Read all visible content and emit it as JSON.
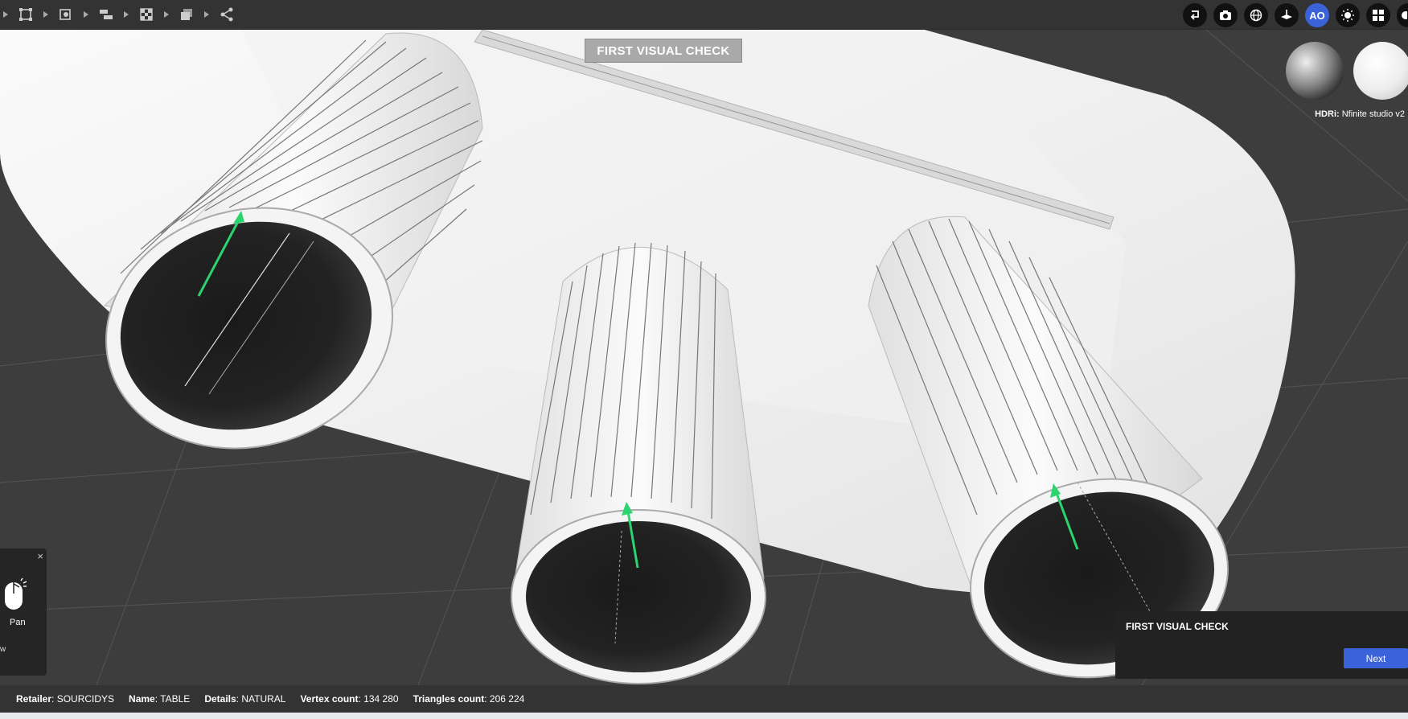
{
  "toolbar": {
    "left_icons": [
      "frame-icon",
      "shape-icon",
      "layers-icon",
      "checker-icon",
      "stack-icon",
      "share-icon"
    ],
    "right_buttons": [
      {
        "name": "undo-button",
        "icon": "return-icon",
        "label": ""
      },
      {
        "name": "camera-button",
        "icon": "camera-icon",
        "label": ""
      },
      {
        "name": "globe-button",
        "icon": "globe-icon",
        "label": ""
      },
      {
        "name": "floor-button",
        "icon": "floor-icon",
        "label": ""
      },
      {
        "name": "ao-button",
        "icon": "",
        "label": "AO"
      },
      {
        "name": "light-button",
        "icon": "sun-icon",
        "label": ""
      },
      {
        "name": "grid-button",
        "icon": "grid-icon",
        "label": ""
      },
      {
        "name": "settings-button",
        "icon": "gear-icon",
        "label": ""
      }
    ]
  },
  "banner": {
    "text": "FIRST VISUAL CHECK"
  },
  "hdri": {
    "label": "HDRi:",
    "value": "Nfinite studio v2"
  },
  "pan_hint": {
    "label": "Pan",
    "secondary": "w",
    "close": "×"
  },
  "check_panel": {
    "title": "FIRST VISUAL CHECK",
    "next_label": "Next"
  },
  "status": {
    "retailer_label": "Retailer",
    "retailer_value": "SOURCIDYS",
    "name_label": "Name",
    "name_value": "TABLE",
    "details_label": "Details",
    "details_value": "NATURAL",
    "vertex_label": "Vertex count",
    "vertex_value": "134 280",
    "triangles_label": "Triangles count",
    "triangles_value": "206 224"
  },
  "colors": {
    "accent": "#3b63d9",
    "normal_arrow": "#2bd46e"
  }
}
